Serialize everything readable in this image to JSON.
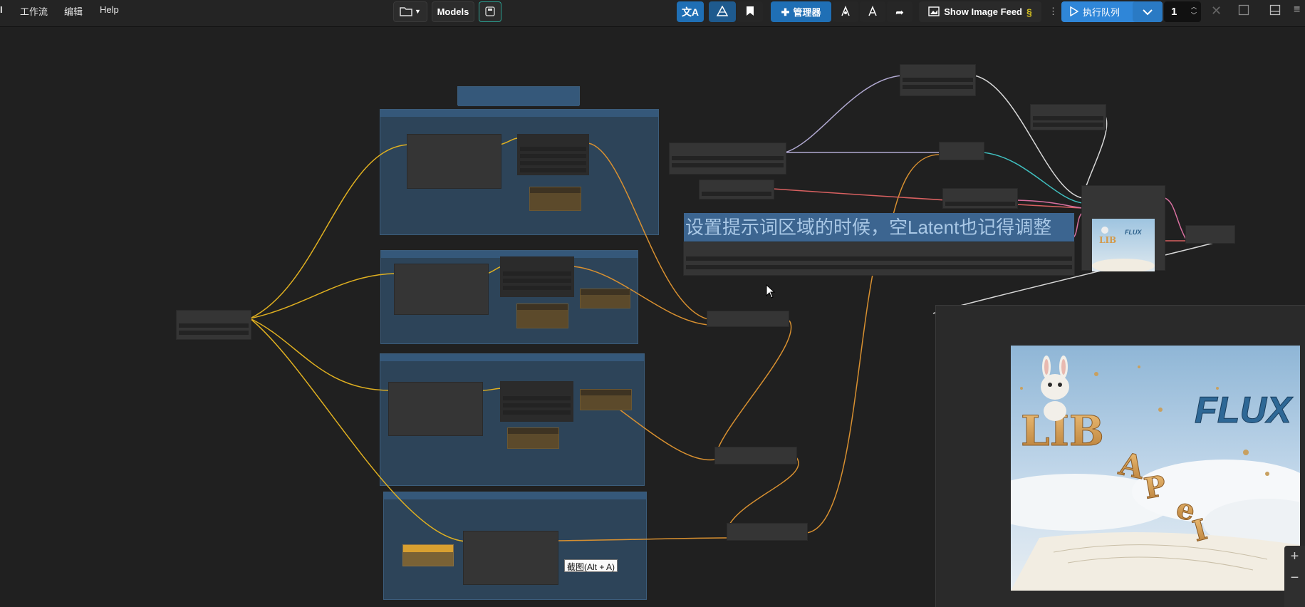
{
  "menu": {
    "partial_logo": "I",
    "items": [
      "工作流",
      "编辑",
      "Help"
    ]
  },
  "toolbar": {
    "models_label": "Models",
    "manager_label": "管理器",
    "image_feed_label": "Show Image Feed",
    "run_label": "执行队列",
    "queue_count": "1"
  },
  "canvas": {
    "note_text": "设置提示词区域的时候，空Latent也记得调整",
    "tooltip_text": "截图(Alt + A)",
    "preview_logo": "FLUX",
    "preview_letters": "LIB APEI"
  },
  "colors": {
    "accent_blue": "#1f6fb5",
    "run_blue": "#2f86d8",
    "group_blue": "#2d4459",
    "wire_yellow": "#e0b020",
    "wire_orange": "#d89030"
  },
  "icons": [
    "folder-icon",
    "chevron-down-icon",
    "save-icon",
    "translate-icon",
    "bookmark-icon",
    "puzzle-icon",
    "play-icon",
    "close-icon",
    "maximize-icon",
    "panel-icon",
    "more-icon",
    "plus-icon",
    "minus-icon"
  ]
}
